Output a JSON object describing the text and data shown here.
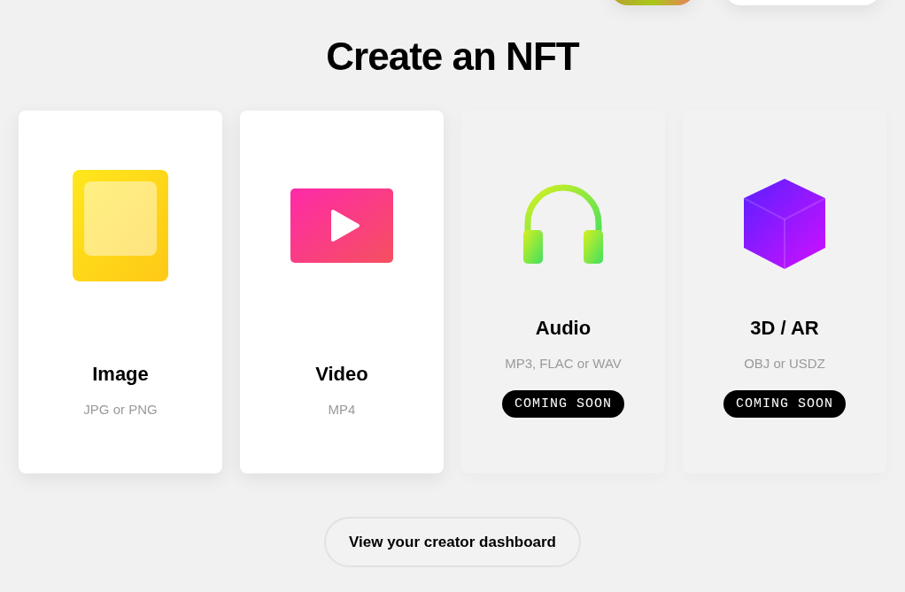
{
  "title": "Create an NFT",
  "cards": [
    {
      "kind": "image",
      "title": "Image",
      "formats": "JPG or PNG",
      "disabled": false
    },
    {
      "kind": "video",
      "title": "Video",
      "formats": "MP4",
      "disabled": false
    },
    {
      "kind": "audio",
      "title": "Audio",
      "formats": "MP3, FLAC or WAV",
      "disabled": true,
      "badge": "COMING SOON"
    },
    {
      "kind": "model",
      "title": "3D / AR",
      "formats": "OBJ or USDZ",
      "disabled": true,
      "badge": "COMING SOON"
    }
  ],
  "dashboard_button": "View your creator dashboard"
}
